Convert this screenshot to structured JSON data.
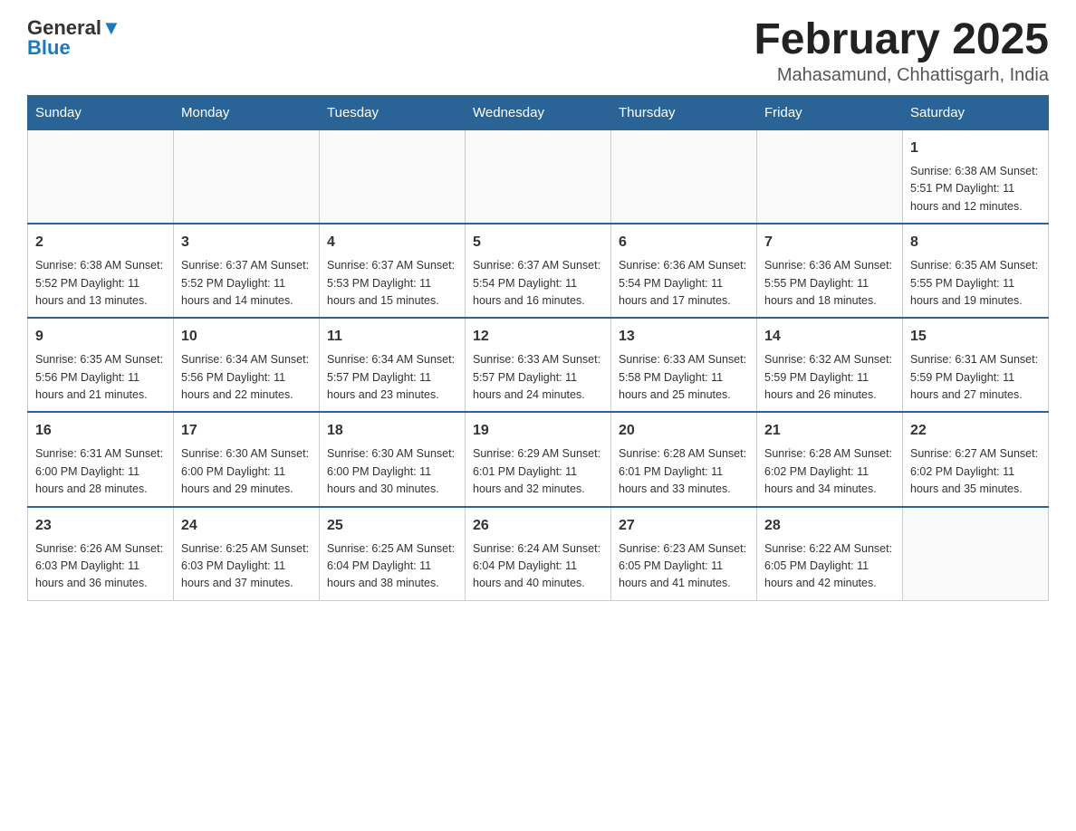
{
  "header": {
    "logo_general": "General",
    "logo_blue": "Blue",
    "title": "February 2025",
    "location": "Mahasamund, Chhattisgarh, India"
  },
  "days_of_week": [
    "Sunday",
    "Monday",
    "Tuesday",
    "Wednesday",
    "Thursday",
    "Friday",
    "Saturday"
  ],
  "weeks": [
    [
      {
        "day": "",
        "info": ""
      },
      {
        "day": "",
        "info": ""
      },
      {
        "day": "",
        "info": ""
      },
      {
        "day": "",
        "info": ""
      },
      {
        "day": "",
        "info": ""
      },
      {
        "day": "",
        "info": ""
      },
      {
        "day": "1",
        "info": "Sunrise: 6:38 AM\nSunset: 5:51 PM\nDaylight: 11 hours and 12 minutes."
      }
    ],
    [
      {
        "day": "2",
        "info": "Sunrise: 6:38 AM\nSunset: 5:52 PM\nDaylight: 11 hours and 13 minutes."
      },
      {
        "day": "3",
        "info": "Sunrise: 6:37 AM\nSunset: 5:52 PM\nDaylight: 11 hours and 14 minutes."
      },
      {
        "day": "4",
        "info": "Sunrise: 6:37 AM\nSunset: 5:53 PM\nDaylight: 11 hours and 15 minutes."
      },
      {
        "day": "5",
        "info": "Sunrise: 6:37 AM\nSunset: 5:54 PM\nDaylight: 11 hours and 16 minutes."
      },
      {
        "day": "6",
        "info": "Sunrise: 6:36 AM\nSunset: 5:54 PM\nDaylight: 11 hours and 17 minutes."
      },
      {
        "day": "7",
        "info": "Sunrise: 6:36 AM\nSunset: 5:55 PM\nDaylight: 11 hours and 18 minutes."
      },
      {
        "day": "8",
        "info": "Sunrise: 6:35 AM\nSunset: 5:55 PM\nDaylight: 11 hours and 19 minutes."
      }
    ],
    [
      {
        "day": "9",
        "info": "Sunrise: 6:35 AM\nSunset: 5:56 PM\nDaylight: 11 hours and 21 minutes."
      },
      {
        "day": "10",
        "info": "Sunrise: 6:34 AM\nSunset: 5:56 PM\nDaylight: 11 hours and 22 minutes."
      },
      {
        "day": "11",
        "info": "Sunrise: 6:34 AM\nSunset: 5:57 PM\nDaylight: 11 hours and 23 minutes."
      },
      {
        "day": "12",
        "info": "Sunrise: 6:33 AM\nSunset: 5:57 PM\nDaylight: 11 hours and 24 minutes."
      },
      {
        "day": "13",
        "info": "Sunrise: 6:33 AM\nSunset: 5:58 PM\nDaylight: 11 hours and 25 minutes."
      },
      {
        "day": "14",
        "info": "Sunrise: 6:32 AM\nSunset: 5:59 PM\nDaylight: 11 hours and 26 minutes."
      },
      {
        "day": "15",
        "info": "Sunrise: 6:31 AM\nSunset: 5:59 PM\nDaylight: 11 hours and 27 minutes."
      }
    ],
    [
      {
        "day": "16",
        "info": "Sunrise: 6:31 AM\nSunset: 6:00 PM\nDaylight: 11 hours and 28 minutes."
      },
      {
        "day": "17",
        "info": "Sunrise: 6:30 AM\nSunset: 6:00 PM\nDaylight: 11 hours and 29 minutes."
      },
      {
        "day": "18",
        "info": "Sunrise: 6:30 AM\nSunset: 6:00 PM\nDaylight: 11 hours and 30 minutes."
      },
      {
        "day": "19",
        "info": "Sunrise: 6:29 AM\nSunset: 6:01 PM\nDaylight: 11 hours and 32 minutes."
      },
      {
        "day": "20",
        "info": "Sunrise: 6:28 AM\nSunset: 6:01 PM\nDaylight: 11 hours and 33 minutes."
      },
      {
        "day": "21",
        "info": "Sunrise: 6:28 AM\nSunset: 6:02 PM\nDaylight: 11 hours and 34 minutes."
      },
      {
        "day": "22",
        "info": "Sunrise: 6:27 AM\nSunset: 6:02 PM\nDaylight: 11 hours and 35 minutes."
      }
    ],
    [
      {
        "day": "23",
        "info": "Sunrise: 6:26 AM\nSunset: 6:03 PM\nDaylight: 11 hours and 36 minutes."
      },
      {
        "day": "24",
        "info": "Sunrise: 6:25 AM\nSunset: 6:03 PM\nDaylight: 11 hours and 37 minutes."
      },
      {
        "day": "25",
        "info": "Sunrise: 6:25 AM\nSunset: 6:04 PM\nDaylight: 11 hours and 38 minutes."
      },
      {
        "day": "26",
        "info": "Sunrise: 6:24 AM\nSunset: 6:04 PM\nDaylight: 11 hours and 40 minutes."
      },
      {
        "day": "27",
        "info": "Sunrise: 6:23 AM\nSunset: 6:05 PM\nDaylight: 11 hours and 41 minutes."
      },
      {
        "day": "28",
        "info": "Sunrise: 6:22 AM\nSunset: 6:05 PM\nDaylight: 11 hours and 42 minutes."
      },
      {
        "day": "",
        "info": ""
      }
    ]
  ]
}
